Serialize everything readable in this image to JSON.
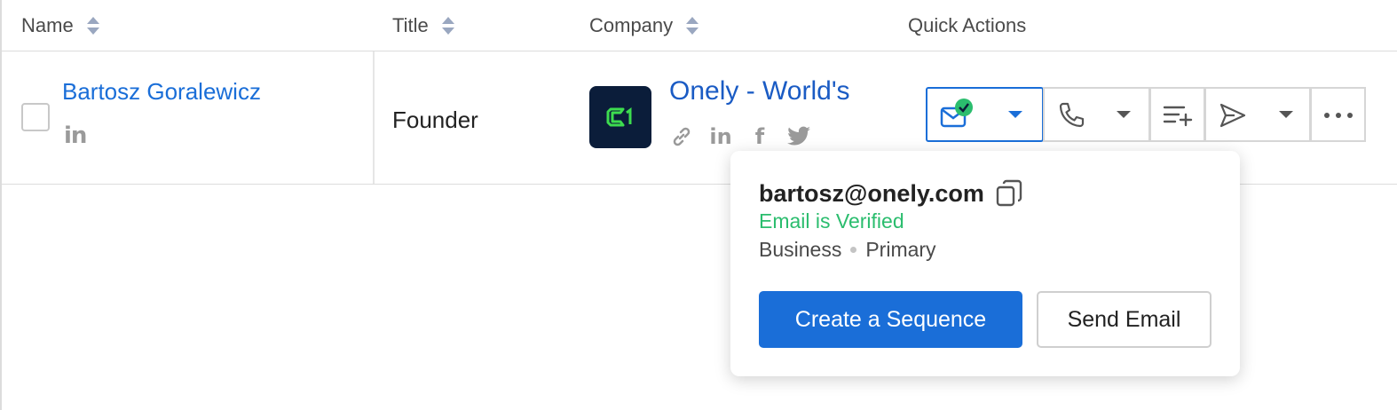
{
  "columns": {
    "name": "Name",
    "title": "Title",
    "company": "Company",
    "quick_actions": "Quick Actions"
  },
  "row": {
    "person_name": "Bartosz Goralewicz",
    "person_linkedin": "in",
    "title": "Founder",
    "company_logo_text": "C1",
    "company_name": "Onely - World's",
    "company_linkedin": "in",
    "company_facebook": "f"
  },
  "popover": {
    "email": "bartosz@onely.com",
    "verified_text": "Email is Verified",
    "type": "Business",
    "priority": "Primary",
    "primary_button": "Create a Sequence",
    "secondary_button": "Send Email"
  },
  "colors": {
    "accent": "#1a6ed8",
    "verified": "#2bbd6e",
    "logo_bg": "#0b1d3a",
    "logo_fg": "#3ddc4f"
  }
}
